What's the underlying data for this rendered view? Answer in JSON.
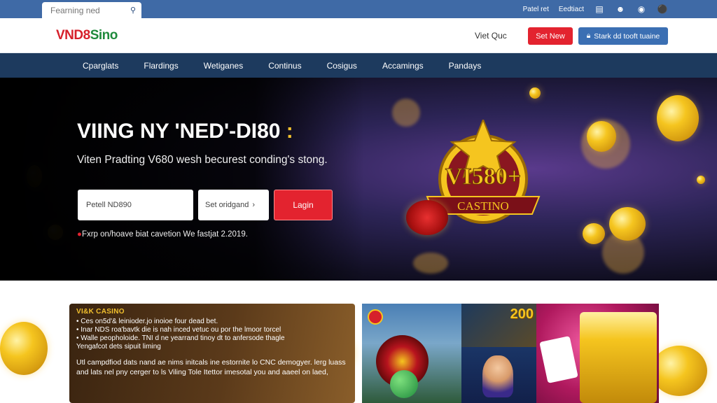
{
  "topbar": {
    "search_placeholder": "Fearning ned",
    "links": [
      "Patel ret",
      "Eedtiact"
    ]
  },
  "header": {
    "logo_part1": "VND8",
    "logo_part2": "Sino",
    "link": "Viet Quc",
    "btn_new": "Set New",
    "btn_start": "Stark dd tooft tuaine"
  },
  "nav": {
    "items": [
      "Cparglats",
      "Flardings",
      "Wetiganes",
      "Continus",
      "Cosigus",
      "Accamings",
      "Pandays"
    ]
  },
  "hero": {
    "title": "VIING NY 'NED'-DI80",
    "title_suffix": ":",
    "subtitle": "Viten Pradting V680 wesh becurest conding's stong.",
    "input_value": "Petell ND890",
    "select_value": "Set oridgand",
    "login_label": "Lagin",
    "note": "Fxrp on/hoave biat cavetion We fastjat 2.2019.",
    "emblem_text_big": "VI580+",
    "emblem_text_small": "CASTINO"
  },
  "card": {
    "title": "VI&K CASINO",
    "list": [
      "Ces on5d'& leinioder.jo inoioe four dead bet.",
      "Inar NDS roa'bavtk die is nah inced vetuc ou por the lmoor torcel",
      "Walle peopholoide. TNI d ne yearrand tinoy dt to anfersode thagle",
      "Yengafcot dets sipuit liming"
    ],
    "body": "Utl campdfiod dats nand ae nims initcals ine estornite lo CNC demogyer. lerg luass and lats nel pny cerger to ls Viling Tole Itettor imesotal you and aaeel on laed,"
  },
  "gallery": {
    "badge": "200"
  },
  "colors": {
    "primary_blue": "#3f6aa6",
    "nav_dark": "#1d3a5e",
    "accent_red": "#e3232f",
    "gold": "#f5c51f"
  }
}
